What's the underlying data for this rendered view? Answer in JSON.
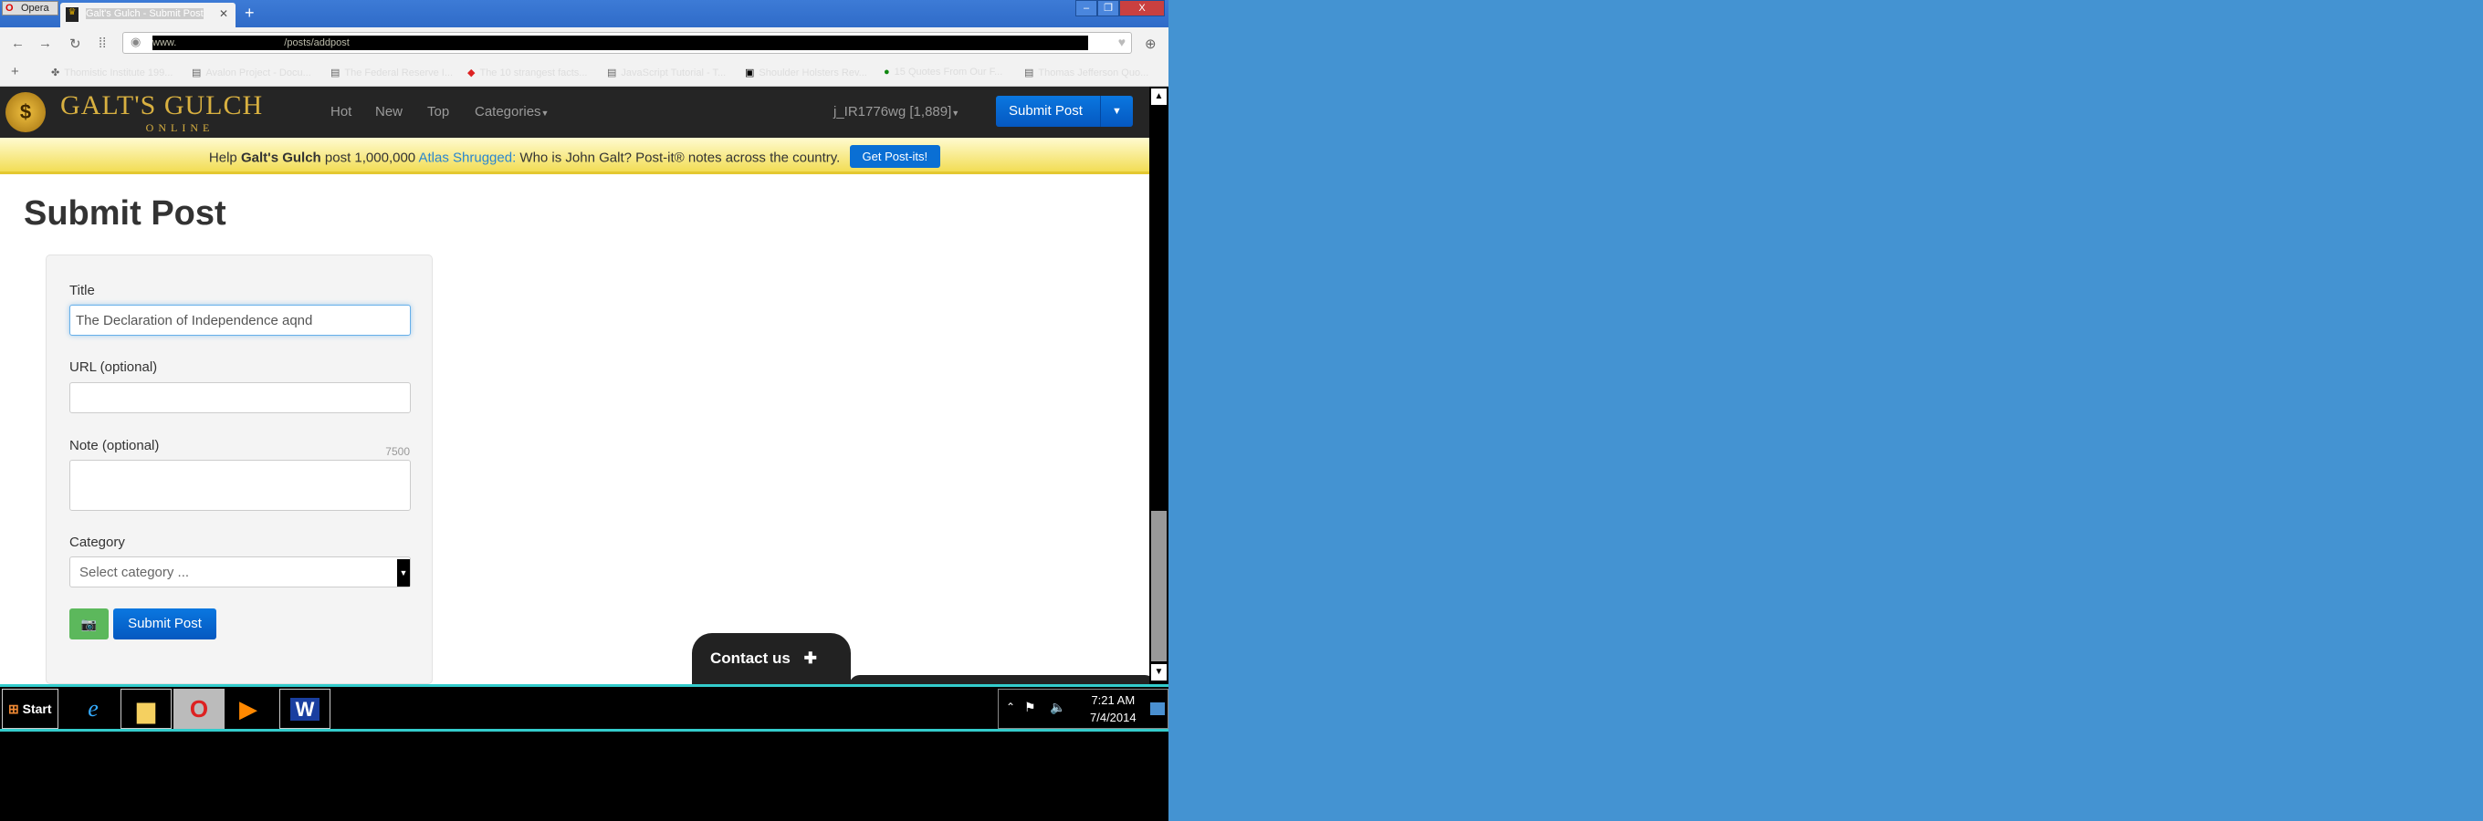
{
  "browser": {
    "app_button": "Opera",
    "tab_title": "Galt's Gulch - Submit Post",
    "url_prefix": "www.",
    "url_path": "/posts/addpost",
    "bookmarks": [
      "Thomistic Institute 199...",
      "Avalon Project - Docu...",
      "The Federal Reserve I...",
      "The 10 strangest facts...",
      "JavaScript Tutorial - T...",
      "Shoulder Holsters Rev...",
      "15 Quotes From Our F...",
      "Thomas Jefferson Quo..."
    ]
  },
  "site": {
    "logo_title": "GALT'S GULCH",
    "logo_subtitle": "ONLINE",
    "nav": [
      "Hot",
      "New",
      "Top",
      "Categories"
    ],
    "user": "j_IR1776wg [1,889]",
    "submit_post": "Submit Post"
  },
  "banner": {
    "help": "Help",
    "brand": "Galt's Gulch",
    "post": "post 1,000,000",
    "link": "Atlas Shrugged:",
    "rest": "Who is John Galt? Post-it® notes across the country.",
    "button": "Get Post-its!"
  },
  "form": {
    "heading": "Submit Post",
    "title_label": "Title",
    "title_value": "The Declaration of Independence aqnd",
    "url_label": "URL (optional)",
    "url_value": "",
    "note_label": "Note (optional)",
    "note_counter": "7500",
    "note_value": "",
    "category_label": "Category",
    "category_placeholder": "Select category ...",
    "submit": "Submit Post"
  },
  "contact": {
    "label": "Contact us"
  },
  "taskbar": {
    "start": "Start",
    "time": "7:21 AM",
    "date": "7/4/2014"
  }
}
